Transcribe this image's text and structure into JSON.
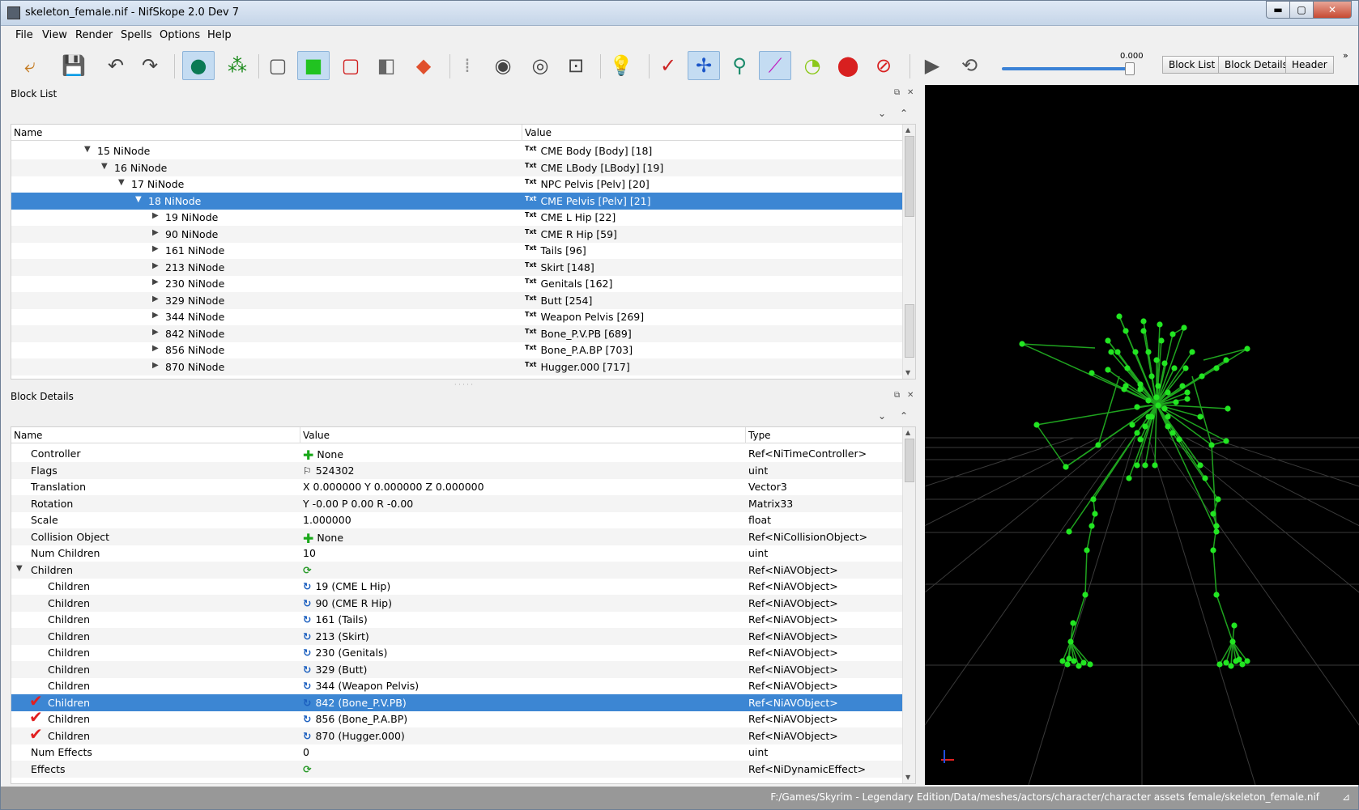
{
  "window": {
    "title": "skeleton_female.nif - NifSkope 2.0 Dev 7",
    "btn_min": "▬",
    "btn_max": "▢",
    "btn_close": "✕"
  },
  "menu": [
    "File",
    "View",
    "Render",
    "Spells",
    "Options",
    "Help"
  ],
  "toolbar": {
    "slider_value": "0.000",
    "dock_buttons": [
      "Block List",
      "Block Details",
      "Header"
    ],
    "more": "»"
  },
  "block_list": {
    "title": "Block List",
    "columns": [
      "Name",
      "Value"
    ],
    "rows": [
      {
        "name": "15 NiNode",
        "value": "CME Body [Body] [18]",
        "level": 0,
        "expanded": true
      },
      {
        "name": "16 NiNode",
        "value": "CME LBody [LBody] [19]",
        "level": 1,
        "expanded": true
      },
      {
        "name": "17 NiNode",
        "value": "NPC Pelvis [Pelv] [20]",
        "level": 2,
        "expanded": true
      },
      {
        "name": "18 NiNode",
        "value": "CME Pelvis [Pelv] [21]",
        "level": 3,
        "expanded": true,
        "selected": true
      },
      {
        "name": "19 NiNode",
        "value": "CME L Hip [22]",
        "level": 4
      },
      {
        "name": "90 NiNode",
        "value": "CME R Hip [59]",
        "level": 4
      },
      {
        "name": "161 NiNode",
        "value": "Tails [96]",
        "level": 4
      },
      {
        "name": "213 NiNode",
        "value": "Skirt [148]",
        "level": 4
      },
      {
        "name": "230 NiNode",
        "value": "Genitals [162]",
        "level": 4
      },
      {
        "name": "329 NiNode",
        "value": "Butt [254]",
        "level": 4
      },
      {
        "name": "344 NiNode",
        "value": "Weapon Pelvis [269]",
        "level": 4
      },
      {
        "name": "842 NiNode",
        "value": "Bone_P.V.PB [689]",
        "level": 4
      },
      {
        "name": "856 NiNode",
        "value": "Bone_P.A.BP [703]",
        "level": 4
      },
      {
        "name": "870 NiNode",
        "value": "Hugger.000 [717]",
        "level": 4
      }
    ]
  },
  "block_details": {
    "title": "Block Details",
    "columns": [
      "Name",
      "Value",
      "Type"
    ],
    "rows": [
      {
        "name": "Controller",
        "value": "None",
        "type": "Ref<NiTimeController>",
        "icon": "plus"
      },
      {
        "name": "Flags",
        "value": "524302",
        "type": "uint",
        "icon": "flag"
      },
      {
        "name": "Translation",
        "value": "X 0.000000 Y 0.000000 Z 0.000000",
        "type": "Vector3"
      },
      {
        "name": "Rotation",
        "value": "Y -0.00 P 0.00 R -0.00",
        "type": "Matrix33"
      },
      {
        "name": "Scale",
        "value": "1.000000",
        "type": "float"
      },
      {
        "name": "Collision Object",
        "value": "None",
        "type": "Ref<NiCollisionObject>",
        "icon": "plus"
      },
      {
        "name": "Num Children",
        "value": "10",
        "type": "uint"
      },
      {
        "name": "Children",
        "value": "",
        "type": "Ref<NiAVObject>",
        "icon": "refs",
        "expanded": true
      },
      {
        "name": "Children",
        "value": "19 (CME L Hip)",
        "type": "Ref<NiAVObject>",
        "icon": "ref",
        "child": true
      },
      {
        "name": "Children",
        "value": "90 (CME R Hip)",
        "type": "Ref<NiAVObject>",
        "icon": "ref",
        "child": true
      },
      {
        "name": "Children",
        "value": "161 (Tails)",
        "type": "Ref<NiAVObject>",
        "icon": "ref",
        "child": true
      },
      {
        "name": "Children",
        "value": "213 (Skirt)",
        "type": "Ref<NiAVObject>",
        "icon": "ref",
        "child": true
      },
      {
        "name": "Children",
        "value": "230 (Genitals)",
        "type": "Ref<NiAVObject>",
        "icon": "ref",
        "child": true
      },
      {
        "name": "Children",
        "value": "329 (Butt)",
        "type": "Ref<NiAVObject>",
        "icon": "ref",
        "child": true
      },
      {
        "name": "Children",
        "value": "344 (Weapon Pelvis)",
        "type": "Ref<NiAVObject>",
        "icon": "ref",
        "child": true
      },
      {
        "name": "Children",
        "value": "842 (Bone_P.V.PB)",
        "type": "Ref<NiAVObject>",
        "icon": "ref",
        "child": true,
        "selected": true,
        "check": true
      },
      {
        "name": "Children",
        "value": "856 (Bone_P.A.BP)",
        "type": "Ref<NiAVObject>",
        "icon": "ref",
        "child": true,
        "check": true
      },
      {
        "name": "Children",
        "value": "870 (Hugger.000)",
        "type": "Ref<NiAVObject>",
        "icon": "ref",
        "child": true,
        "check": true
      },
      {
        "name": "Num Effects",
        "value": "0",
        "type": "uint"
      },
      {
        "name": "Effects",
        "value": "",
        "type": "Ref<NiDynamicEffect>",
        "icon": "refs"
      }
    ]
  },
  "status": {
    "path": "F:/Games/Skyrim - Legendary Edition/Data/meshes/actors/character/character assets female/skeleton_female.nif",
    "grip": "⊿"
  },
  "colors": {
    "selection": "#3c86d3",
    "bone": "#22e622",
    "viewport_bg": "#000000"
  }
}
